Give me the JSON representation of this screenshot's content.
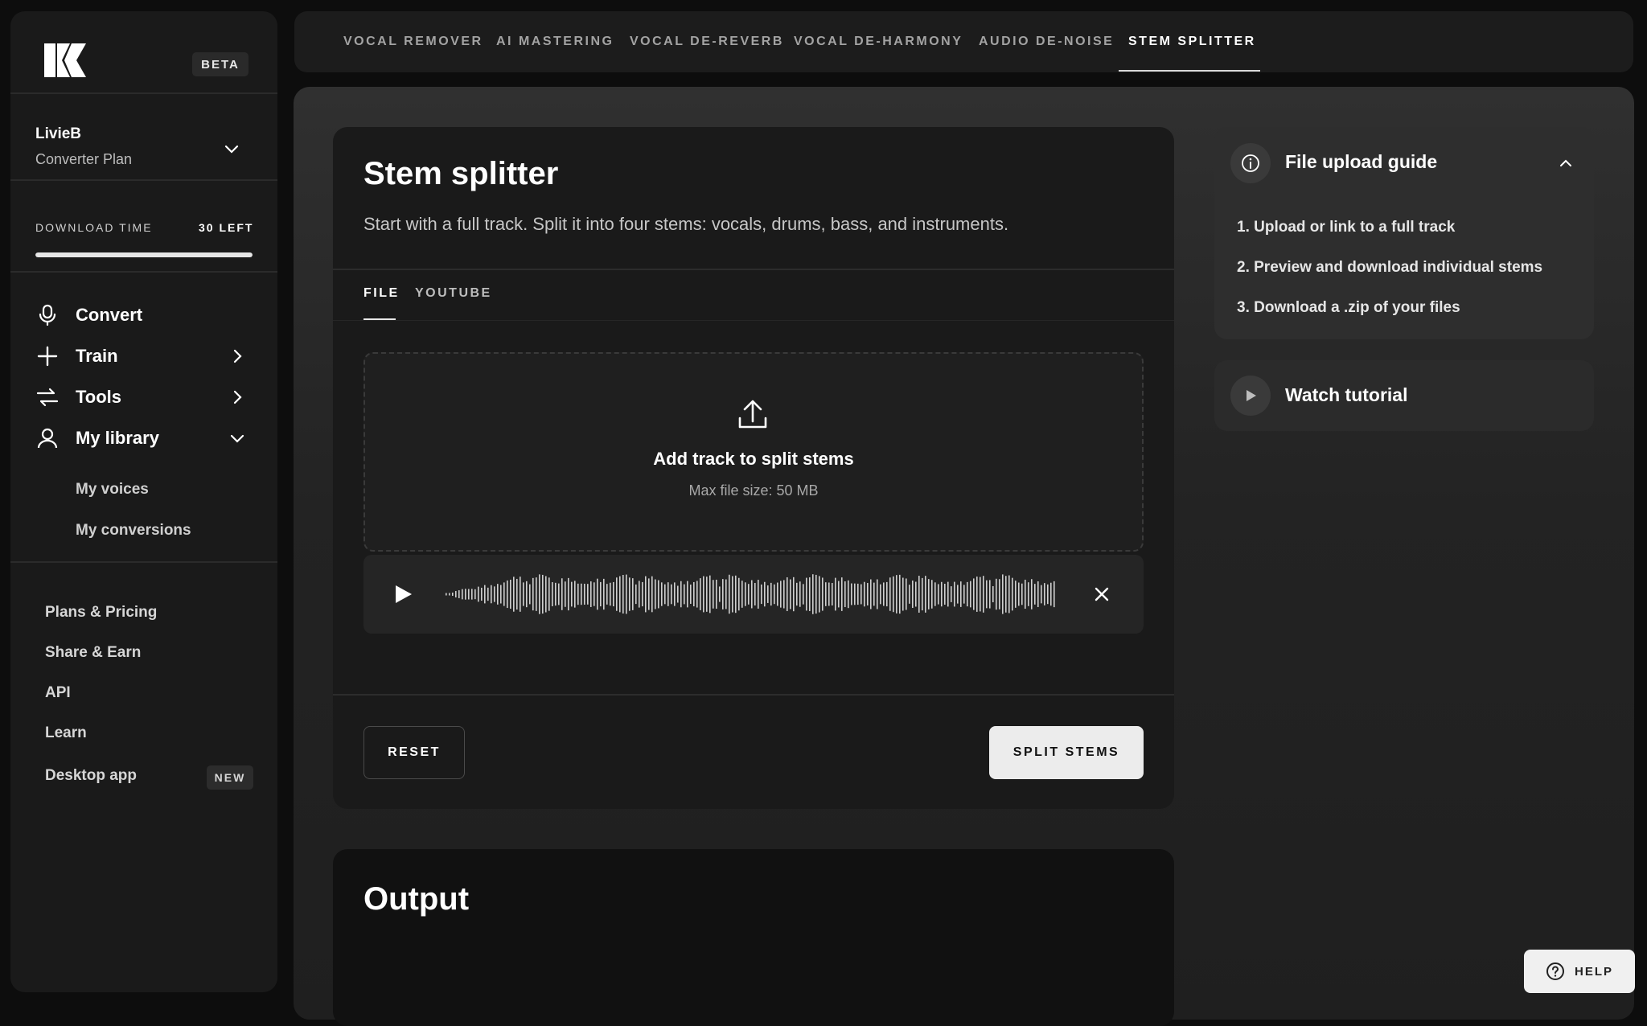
{
  "sidebar": {
    "beta_badge": "BETA",
    "user": {
      "name": "LivieB",
      "plan": "Converter Plan"
    },
    "download": {
      "label": "DOWNLOAD TIME",
      "value": "30 LEFT",
      "fill_fraction": 1.0
    },
    "nav": [
      {
        "label": "Convert",
        "icon": "microphone-icon"
      },
      {
        "label": "Train",
        "icon": "plus-icon"
      },
      {
        "label": "Tools",
        "icon": "tools-icon"
      },
      {
        "label": "My library",
        "icon": "user-icon"
      }
    ],
    "library_items": [
      "My voices",
      "My conversions"
    ],
    "footer": [
      "Plans & Pricing",
      "Share & Earn",
      "API",
      "Learn",
      "Desktop app"
    ],
    "new_badge": "NEW"
  },
  "top_tabs": [
    {
      "label": "VOCAL REMOVER"
    },
    {
      "label": "AI MASTERING"
    },
    {
      "label": "VOCAL DE-REVERB"
    },
    {
      "label": "VOCAL DE-HARMONY"
    },
    {
      "label": "AUDIO DE-NOISE"
    },
    {
      "label": "STEM SPLITTER",
      "active": true
    }
  ],
  "card": {
    "title": "Stem splitter",
    "description": "Start with a full track. Split it into four stems: vocals, drums, bass, and instruments.",
    "tabs": [
      "FILE",
      "YOUTUBE"
    ],
    "dropzone": {
      "title": "Add track to split stems",
      "subtitle": "Max file size: 50 MB"
    },
    "reset_label": "RESET",
    "split_label": "SPLIT STEMS"
  },
  "output": {
    "title": "Output"
  },
  "guide": {
    "title": "File upload guide",
    "steps": [
      "1. Upload or link to a full track",
      "2. Preview and download individual stems",
      "3. Download a .zip of your files"
    ]
  },
  "tutorial": {
    "title": "Watch tutorial"
  },
  "help": {
    "label": "HELP"
  },
  "colors": {
    "accent": "#ececec",
    "background": "#0d0d0d",
    "panel": "#1a1a1a"
  }
}
